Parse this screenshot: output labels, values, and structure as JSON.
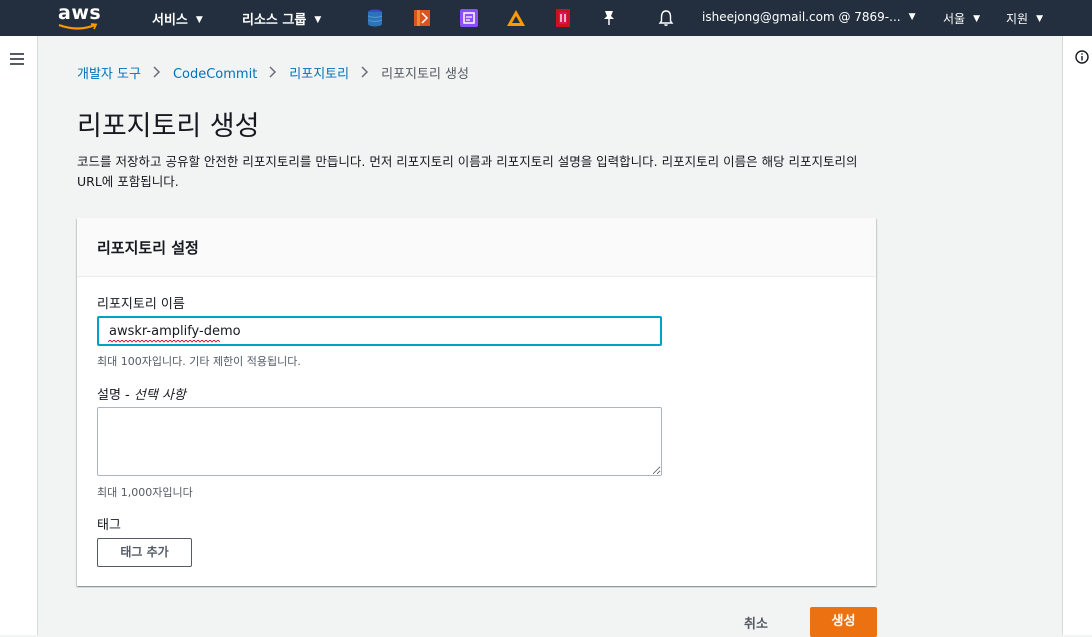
{
  "topnav": {
    "logo": "aws",
    "services": "서비스",
    "resource_groups": "리소스 그룹",
    "service_icons": [
      "dynamodb-icon",
      "codecommit-icon",
      "amplify-console-icon",
      "amplify-icon",
      "codepipeline-icon"
    ],
    "account": "isheejong@gmail.com @ 7869-...",
    "region": "서울",
    "support": "지원",
    "colors": {
      "bar": "#232f3e",
      "smile": "#ff9900"
    }
  },
  "breadcrumb": {
    "items": [
      "개발자 도구",
      "CodeCommit",
      "리포지토리"
    ],
    "current": "리포지토리 생성"
  },
  "page": {
    "title": "리포지토리 생성",
    "description": "코드를 저장하고 공유할 안전한 리포지토리를 만듭니다. 먼저 리포지토리 이름과 리포지토리 설명을 입력합니다. 리포지토리 이름은 해당 리포지토리의 URL에 포함됩니다."
  },
  "panel": {
    "title": "리포지토리 설정",
    "name_label": "리포지토리 이름",
    "name_value": "awskr-amplify-demo",
    "name_hint": "최대 100자입니다. 기타 제한이 적용됩니다.",
    "desc_label": "설명 - ",
    "desc_optional": "선택 사항",
    "desc_value": "",
    "desc_hint": "최대 1,000자입니다",
    "tags_label": "태그",
    "add_tag_button": "태그 추가"
  },
  "actions": {
    "cancel": "취소",
    "create": "생성",
    "primary_color": "#ec7211",
    "focus_color": "#00a1c9",
    "link_color": "#0073bb"
  }
}
